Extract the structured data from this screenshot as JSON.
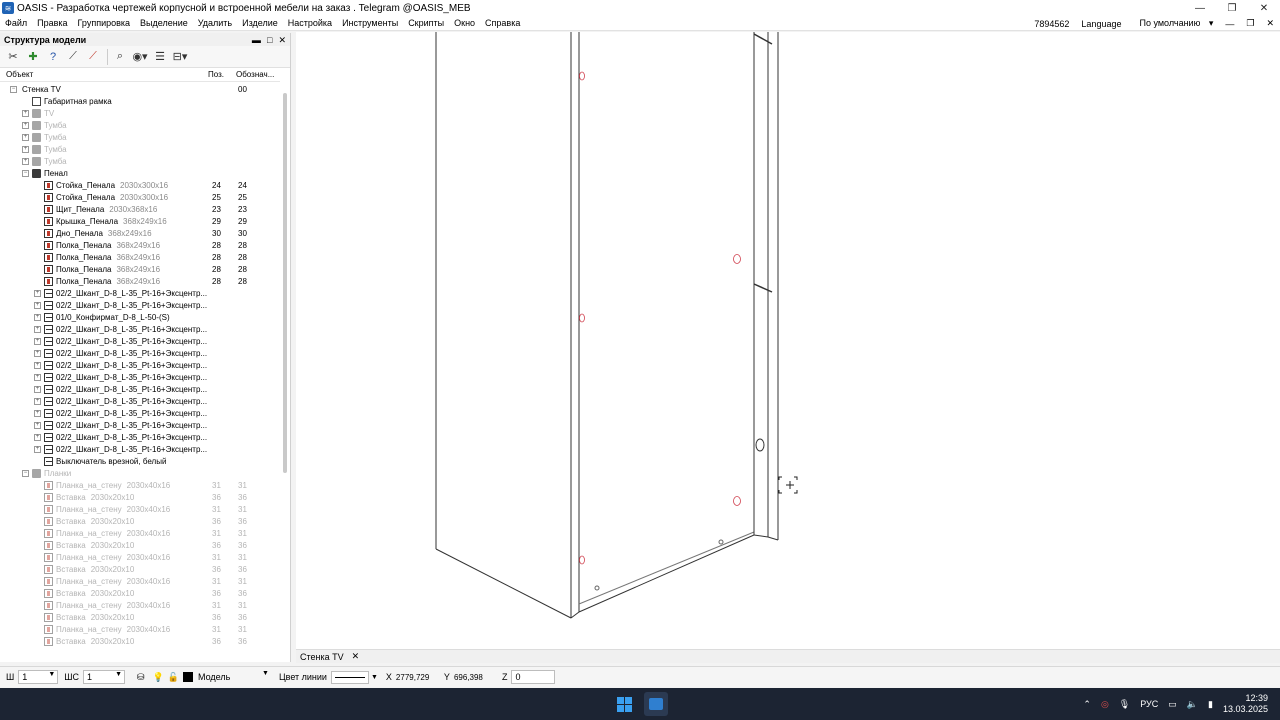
{
  "window": {
    "title": "OASIS -  Разработка чертежей корпусной и встроенной мебели на заказ . Telegram @OASIS_MEB",
    "app_icon": "oasis-icon"
  },
  "menu": {
    "items": [
      "Файл",
      "Правка",
      "Группировка",
      "Выделение",
      "Удалить",
      "Изделие",
      "Настройка",
      "Инструменты",
      "Скрипты",
      "Окно",
      "Справка"
    ],
    "right": {
      "id": "7894562",
      "language": "Language",
      "preset": "По умолчанию"
    }
  },
  "panel": {
    "title": "Структура модели",
    "columns": {
      "object": "Объект",
      "pos": "Поз.",
      "designation": "Обознач..."
    },
    "tree": [
      {
        "level": 0,
        "exp": "−",
        "icon": "none",
        "name": "Стенка TV",
        "dim": "",
        "pos": "",
        "des": "00",
        "grey": false
      },
      {
        "level": 1,
        "exp": "",
        "icon": "frame",
        "name": "Габаритная рамка",
        "dim": "",
        "pos": "",
        "des": "",
        "grey": false
      },
      {
        "level": 1,
        "exp": "+",
        "icon": "folder",
        "name": "TV",
        "dim": "",
        "pos": "",
        "des": "",
        "grey": true
      },
      {
        "level": 1,
        "exp": "+",
        "icon": "folder",
        "name": "Тумба",
        "dim": "",
        "pos": "",
        "des": "",
        "grey": true
      },
      {
        "level": 1,
        "exp": "+",
        "icon": "folder",
        "name": "Тумба",
        "dim": "",
        "pos": "",
        "des": "",
        "grey": true
      },
      {
        "level": 1,
        "exp": "+",
        "icon": "folder",
        "name": "Тумба",
        "dim": "",
        "pos": "",
        "des": "",
        "grey": true
      },
      {
        "level": 1,
        "exp": "+",
        "icon": "folder",
        "name": "Тумба",
        "dim": "",
        "pos": "",
        "des": "",
        "grey": true
      },
      {
        "level": 1,
        "exp": "−",
        "icon": "folder",
        "name": "Пенал",
        "dim": "",
        "pos": "",
        "des": "",
        "grey": false
      },
      {
        "level": 2,
        "exp": "",
        "icon": "part",
        "name": "Стойка_Пенала",
        "dim": "2030x300x16",
        "pos": "24",
        "des": "24",
        "grey": false
      },
      {
        "level": 2,
        "exp": "",
        "icon": "part",
        "name": "Стойка_Пенала",
        "dim": "2030x300x16",
        "pos": "25",
        "des": "25",
        "grey": false
      },
      {
        "level": 2,
        "exp": "",
        "icon": "part",
        "name": "Щит_Пенала",
        "dim": "2030x368x16",
        "pos": "23",
        "des": "23",
        "grey": false
      },
      {
        "level": 2,
        "exp": "",
        "icon": "part",
        "name": "Крышка_Пенала",
        "dim": "368x249x16",
        "pos": "29",
        "des": "29",
        "grey": false
      },
      {
        "level": 2,
        "exp": "",
        "icon": "part",
        "name": "Дно_Пенала",
        "dim": "368x249x16",
        "pos": "30",
        "des": "30",
        "grey": false
      },
      {
        "level": 2,
        "exp": "",
        "icon": "part",
        "name": "Полка_Пенала",
        "dim": "368x249x16",
        "pos": "28",
        "des": "28",
        "grey": false
      },
      {
        "level": 2,
        "exp": "",
        "icon": "part",
        "name": "Полка_Пенала",
        "dim": "368x249x16",
        "pos": "28",
        "des": "28",
        "grey": false
      },
      {
        "level": 2,
        "exp": "",
        "icon": "part",
        "name": "Полка_Пенала",
        "dim": "368x249x16",
        "pos": "28",
        "des": "28",
        "grey": false
      },
      {
        "level": 2,
        "exp": "",
        "icon": "part",
        "name": "Полка_Пенала",
        "dim": "368x249x16",
        "pos": "28",
        "des": "28",
        "grey": false
      },
      {
        "level": 2,
        "exp": "+",
        "icon": "fast",
        "name": "02/2_Шкант_D-8_L-35_Pt-16+Эксцентр...",
        "dim": "",
        "pos": "",
        "des": "",
        "grey": false
      },
      {
        "level": 2,
        "exp": "+",
        "icon": "fast",
        "name": "02/2_Шкант_D-8_L-35_Pt-16+Эксцентр...",
        "dim": "",
        "pos": "",
        "des": "",
        "grey": false
      },
      {
        "level": 2,
        "exp": "+",
        "icon": "fast",
        "name": "01/0_Конфирмат_D-8_L-50-(S)",
        "dim": "",
        "pos": "",
        "des": "",
        "grey": false
      },
      {
        "level": 2,
        "exp": "+",
        "icon": "fast",
        "name": "02/2_Шкант_D-8_L-35_Pt-16+Эксцентр...",
        "dim": "",
        "pos": "",
        "des": "",
        "grey": false
      },
      {
        "level": 2,
        "exp": "+",
        "icon": "fast",
        "name": "02/2_Шкант_D-8_L-35_Pt-16+Эксцентр...",
        "dim": "",
        "pos": "",
        "des": "",
        "grey": false
      },
      {
        "level": 2,
        "exp": "+",
        "icon": "fast",
        "name": "02/2_Шкант_D-8_L-35_Pt-16+Эксцентр...",
        "dim": "",
        "pos": "",
        "des": "",
        "grey": false
      },
      {
        "level": 2,
        "exp": "+",
        "icon": "fast",
        "name": "02/2_Шкант_D-8_L-35_Pt-16+Эксцентр...",
        "dim": "",
        "pos": "",
        "des": "",
        "grey": false
      },
      {
        "level": 2,
        "exp": "+",
        "icon": "fast",
        "name": "02/2_Шкант_D-8_L-35_Pt-16+Эксцентр...",
        "dim": "",
        "pos": "",
        "des": "",
        "grey": false
      },
      {
        "level": 2,
        "exp": "+",
        "icon": "fast",
        "name": "02/2_Шкант_D-8_L-35_Pt-16+Эксцентр...",
        "dim": "",
        "pos": "",
        "des": "",
        "grey": false
      },
      {
        "level": 2,
        "exp": "+",
        "icon": "fast",
        "name": "02/2_Шкант_D-8_L-35_Pt-16+Эксцентр...",
        "dim": "",
        "pos": "",
        "des": "",
        "grey": false
      },
      {
        "level": 2,
        "exp": "+",
        "icon": "fast",
        "name": "02/2_Шкант_D-8_L-35_Pt-16+Эксцентр...",
        "dim": "",
        "pos": "",
        "des": "",
        "grey": false
      },
      {
        "level": 2,
        "exp": "+",
        "icon": "fast",
        "name": "02/2_Шкант_D-8_L-35_Pt-16+Эксцентр...",
        "dim": "",
        "pos": "",
        "des": "",
        "grey": false
      },
      {
        "level": 2,
        "exp": "+",
        "icon": "fast",
        "name": "02/2_Шкант_D-8_L-35_Pt-16+Эксцентр...",
        "dim": "",
        "pos": "",
        "des": "",
        "grey": false
      },
      {
        "level": 2,
        "exp": "+",
        "icon": "fast",
        "name": "02/2_Шкант_D-8_L-35_Pt-16+Эксцентр...",
        "dim": "",
        "pos": "",
        "des": "",
        "grey": false
      },
      {
        "level": 2,
        "exp": "",
        "icon": "fast",
        "name": "Выключатель врезной, белый",
        "dim": "",
        "pos": "",
        "des": "",
        "grey": false
      },
      {
        "level": 1,
        "exp": "−",
        "icon": "folder",
        "name": "Планки",
        "dim": "",
        "pos": "",
        "des": "",
        "grey": true
      },
      {
        "level": 2,
        "exp": "",
        "icon": "part",
        "name": "Планка_на_стену",
        "dim": "2030x40x16",
        "pos": "31",
        "des": "31",
        "grey": true
      },
      {
        "level": 2,
        "exp": "",
        "icon": "part",
        "name": "Вставка",
        "dim": "2030x20x10",
        "pos": "36",
        "des": "36",
        "grey": true
      },
      {
        "level": 2,
        "exp": "",
        "icon": "part",
        "name": "Планка_на_стену",
        "dim": "2030x40x16",
        "pos": "31",
        "des": "31",
        "grey": true
      },
      {
        "level": 2,
        "exp": "",
        "icon": "part",
        "name": "Вставка",
        "dim": "2030x20x10",
        "pos": "36",
        "des": "36",
        "grey": true
      },
      {
        "level": 2,
        "exp": "",
        "icon": "part",
        "name": "Планка_на_стену",
        "dim": "2030x40x16",
        "pos": "31",
        "des": "31",
        "grey": true
      },
      {
        "level": 2,
        "exp": "",
        "icon": "part",
        "name": "Вставка",
        "dim": "2030x20x10",
        "pos": "36",
        "des": "36",
        "grey": true
      },
      {
        "level": 2,
        "exp": "",
        "icon": "part",
        "name": "Планка_на_стену",
        "dim": "2030x40x16",
        "pos": "31",
        "des": "31",
        "grey": true
      },
      {
        "level": 2,
        "exp": "",
        "icon": "part",
        "name": "Вставка",
        "dim": "2030x20x10",
        "pos": "36",
        "des": "36",
        "grey": true
      },
      {
        "level": 2,
        "exp": "",
        "icon": "part",
        "name": "Планка_на_стену",
        "dim": "2030x40x16",
        "pos": "31",
        "des": "31",
        "grey": true
      },
      {
        "level": 2,
        "exp": "",
        "icon": "part",
        "name": "Вставка",
        "dim": "2030x20x10",
        "pos": "36",
        "des": "36",
        "grey": true
      },
      {
        "level": 2,
        "exp": "",
        "icon": "part",
        "name": "Планка_на_стену",
        "dim": "2030x40x16",
        "pos": "31",
        "des": "31",
        "grey": true
      },
      {
        "level": 2,
        "exp": "",
        "icon": "part",
        "name": "Вставка",
        "dim": "2030x20x10",
        "pos": "36",
        "des": "36",
        "grey": true
      },
      {
        "level": 2,
        "exp": "",
        "icon": "part",
        "name": "Планка_на_стену",
        "dim": "2030x40x16",
        "pos": "31",
        "des": "31",
        "grey": true
      },
      {
        "level": 2,
        "exp": "",
        "icon": "part",
        "name": "Вставка",
        "dim": "2030x20x10",
        "pos": "36",
        "des": "36",
        "grey": true
      }
    ]
  },
  "document_tab": {
    "label": "Стенка TV"
  },
  "bottom": {
    "w_label": "Ш",
    "w_value": "1",
    "ws_label": "ШС",
    "ws_value": "1",
    "layer": "Модель",
    "line_color_label": "Цвет линии",
    "x_label": "X",
    "x_value": "2779,729",
    "y_label": "Y",
    "y_value": "696,398",
    "z_label": "Z",
    "z_value": "0"
  },
  "taskbar": {
    "lang": "РУС",
    "time": "12:39",
    "date": "13.03.2025"
  },
  "colors": {
    "accent": "#1f63b5",
    "hole": "#d0404e",
    "taskbar": "#1c2433"
  }
}
